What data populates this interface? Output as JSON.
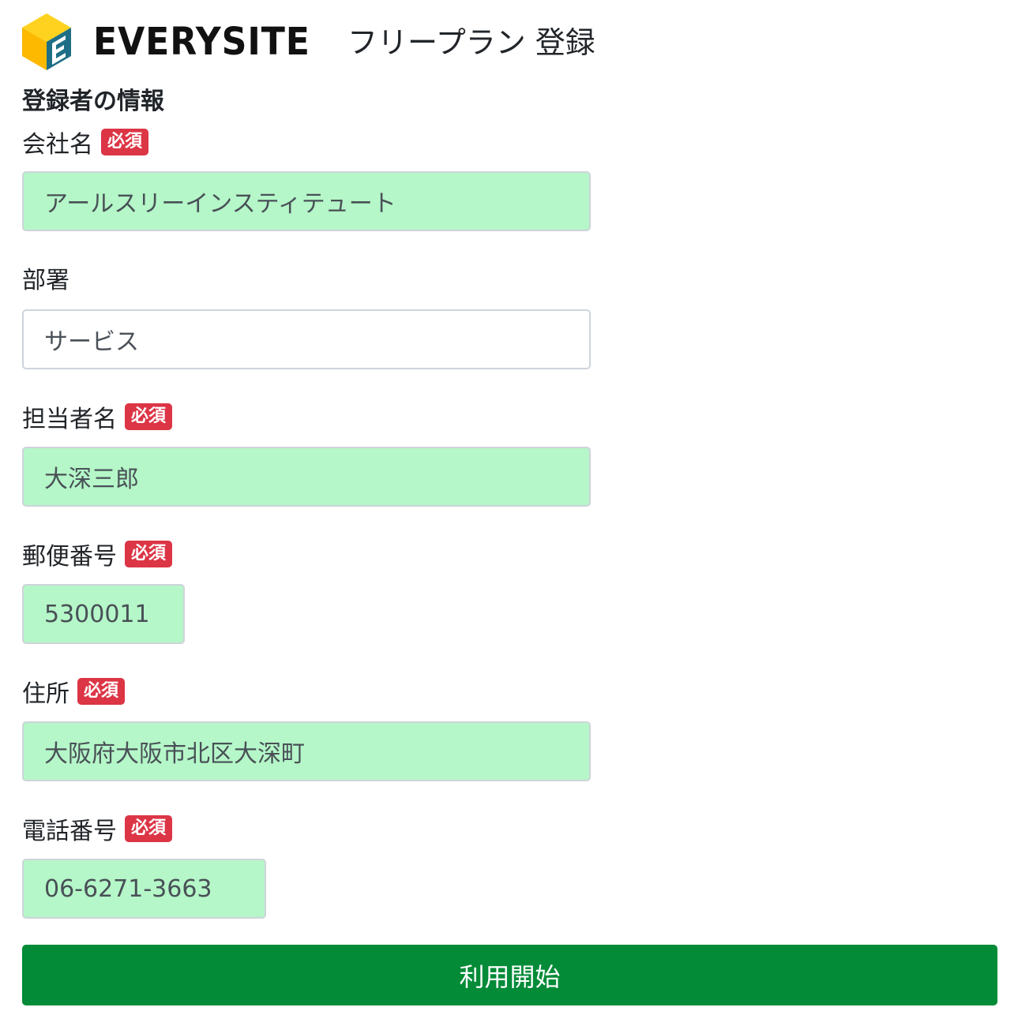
{
  "header": {
    "logo_text": "EVERYSITE",
    "page_title": "フリープラン 登録"
  },
  "form": {
    "section_title": "登録者の情報",
    "required_badge": "必須",
    "fields": [
      {
        "label": "会社名",
        "required": true,
        "value": "アールスリーインスティテュート"
      },
      {
        "label": "部署",
        "required": false,
        "value": "サービス"
      },
      {
        "label": "担当者名",
        "required": true,
        "value": "大深三郎"
      },
      {
        "label": "郵便番号",
        "required": true,
        "value": "5300011"
      },
      {
        "label": "住所",
        "required": true,
        "value": "大阪府大阪市北区大深町"
      },
      {
        "label": "電話番号",
        "required": true,
        "value": "06-6271-3663"
      }
    ],
    "submit_label": "利用開始"
  },
  "colors": {
    "filled_field": "#b5f7c8",
    "required_badge": "#dc3545",
    "submit_button": "#048b38",
    "logo_yellow": "#fcb900",
    "logo_teal": "#1e6f86"
  }
}
